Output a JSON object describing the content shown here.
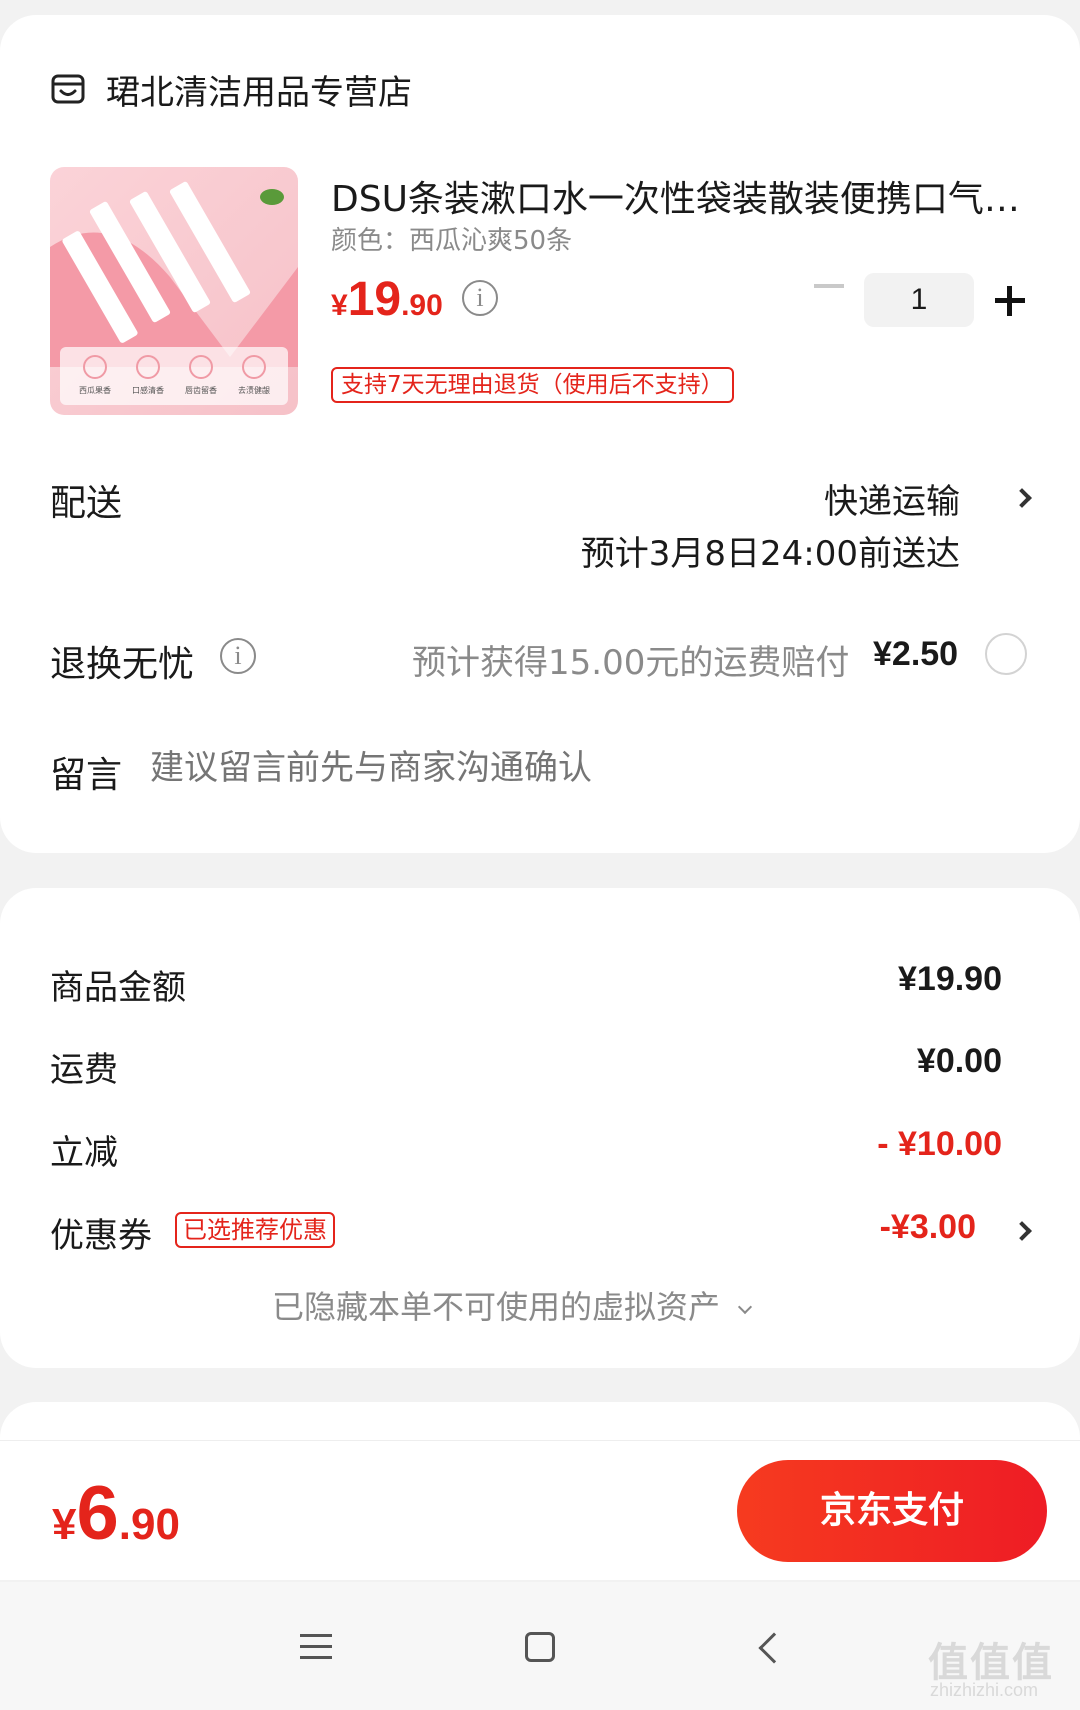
{
  "store": {
    "name": "珺北清洁用品专营店",
    "icon": "store-icon"
  },
  "product": {
    "title": "DSU条装漱口水一次性袋装散装便携口气…",
    "variant": "颜色：西瓜沁爽50条",
    "price_currency": "¥",
    "price_int": "19",
    "price_dec": ".90",
    "quantity": "1",
    "return_policy": "支持7天无理由退货（使用后不支持）",
    "thumb_labels": [
      "西瓜果香",
      "口感清香",
      "唇齿留香",
      "去渍健龈"
    ]
  },
  "delivery": {
    "label": "配送",
    "method": "快递运输",
    "eta": "预计3月8日24:00前送达"
  },
  "worry_free": {
    "label": "退换无忧",
    "desc": "预计获得15.00元的运费赔付",
    "price": "¥2.50"
  },
  "message": {
    "label": "留言",
    "placeholder": "建议留言前先与商家沟通确认"
  },
  "summary": {
    "goods_label": "商品金额",
    "goods_value": "¥19.90",
    "shipping_label": "运费",
    "shipping_value": "¥0.00",
    "discount_label": "立减",
    "discount_value": "- ¥10.00",
    "coupon_label": "优惠券",
    "coupon_tag": "已选推荐优惠",
    "coupon_value": "-¥3.00",
    "hidden_assets": "已隐藏本单不可使用的虚拟资产"
  },
  "payment": {
    "total_currency": "¥",
    "total_int": "6",
    "total_dec": ".90",
    "pay_button": "京东支付"
  },
  "watermark": {
    "main": "值值值",
    "sub": "zhizhizhi.com"
  },
  "colors": {
    "accent": "#e4241b",
    "muted": "#8a8a8a",
    "background": "#f2f2f2"
  }
}
